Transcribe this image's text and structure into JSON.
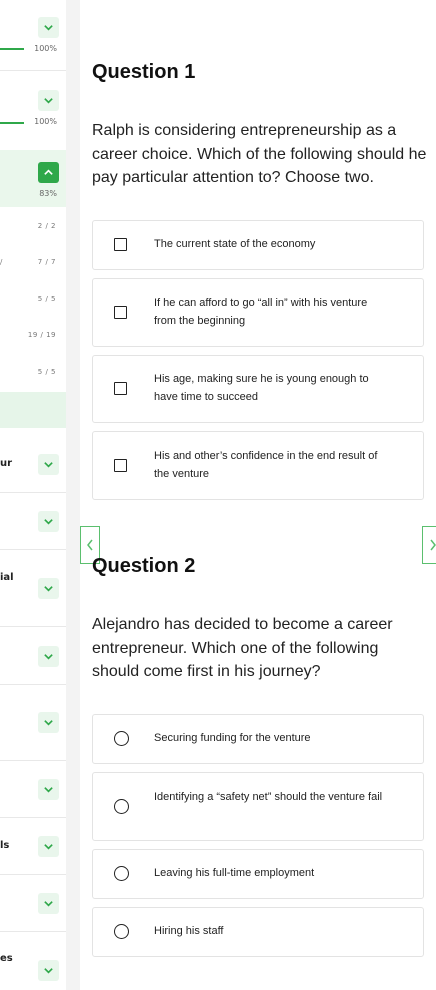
{
  "sidebar": {
    "modules": [
      {
        "progress_pct": "100%",
        "expanded": false
      },
      {
        "progress_pct": "100%",
        "expanded": false
      },
      {
        "progress_pct": "83%",
        "expanded": true
      }
    ],
    "lesson_rows": [
      {
        "count": "2 / 2"
      },
      {
        "count": "7 / 7"
      },
      {
        "count": "5 / 5"
      },
      {
        "count": "19 / 19"
      },
      {
        "count": "5 / 5"
      }
    ],
    "slash_char": "/",
    "collapsed_labels": [
      "ur",
      "",
      "ial",
      "",
      "",
      "",
      "ls",
      "",
      "es"
    ]
  },
  "questions": [
    {
      "title": "Question 1",
      "text": "Ralph is considering entrepreneurship as a career choice. Which of the following should he pay particular attention to? Choose two.",
      "input_type": "checkbox",
      "options": [
        "The current state of the economy",
        "If he can afford to go “all in” with his venture from the beginning",
        "His age, making sure he is young enough to have time to succeed",
        "His and other’s confidence in the end result of the venture"
      ]
    },
    {
      "title": "Question 2",
      "text": "Alejandro has decided to become a career entrepreneur. Which one of the following should come first in his journey?",
      "input_type": "radio",
      "options": [
        "Securing funding for the venture",
        "Identifying a “safety net” should the venture fail",
        "Leaving his full-time employment",
        "Hiring his staff"
      ]
    }
  ],
  "icons": {
    "toggle": "chevron-down-icon",
    "toggle_open": "chevron-up-icon",
    "prev": "chevron-left-icon",
    "next": "chevron-right-icon"
  },
  "colors": {
    "accent": "#2fa84a",
    "accent_light": "#e9f6ec",
    "border": "#e3e3e3"
  }
}
